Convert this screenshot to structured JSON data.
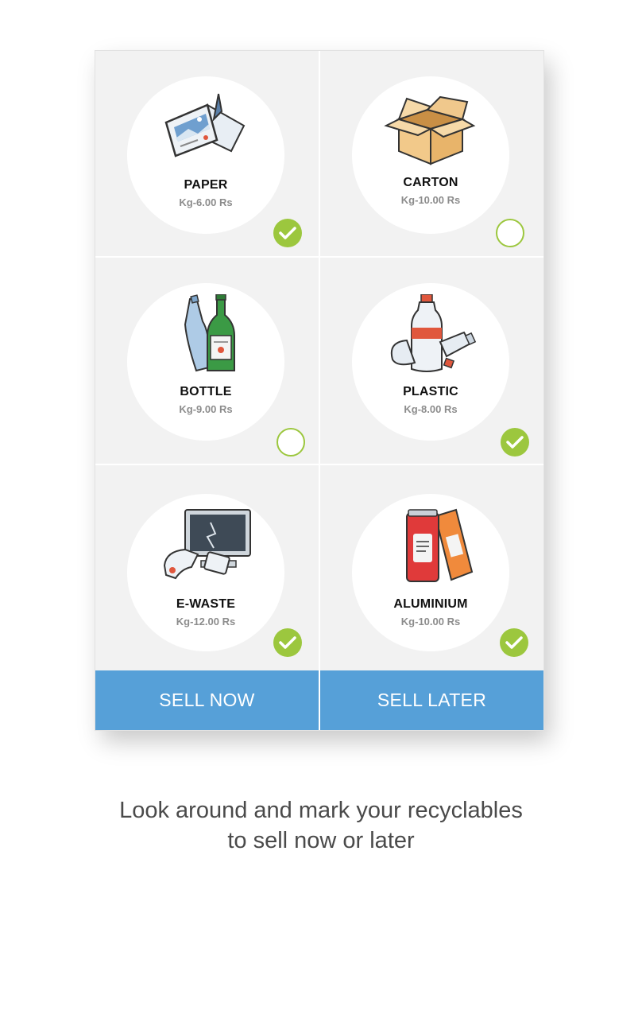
{
  "items": [
    {
      "name": "PAPER",
      "price": "Kg-6.00 Rs",
      "checked": true,
      "icon": "paper-icon"
    },
    {
      "name": "CARTON",
      "price": "Kg-10.00 Rs",
      "checked": false,
      "icon": "carton-icon"
    },
    {
      "name": "BOTTLE",
      "price": "Kg-9.00 Rs",
      "checked": false,
      "icon": "bottle-icon"
    },
    {
      "name": "PLASTIC",
      "price": "Kg-8.00 Rs",
      "checked": true,
      "icon": "plastic-icon"
    },
    {
      "name": "E-WASTE",
      "price": "Kg-12.00 Rs",
      "checked": true,
      "icon": "e-waste-icon"
    },
    {
      "name": "ALUMINIUM",
      "price": "Kg-10.00 Rs",
      "checked": true,
      "icon": "aluminium-can-icon"
    }
  ],
  "buttons": {
    "sell_now": "SELL NOW",
    "sell_later": "SELL LATER"
  },
  "caption": {
    "line1": "Look around and mark your recyclables",
    "line2": "to sell now or later"
  },
  "colors": {
    "accent_green": "#9cc73e",
    "button_blue": "#56a0d8",
    "tile_bg": "#f2f2f2"
  }
}
